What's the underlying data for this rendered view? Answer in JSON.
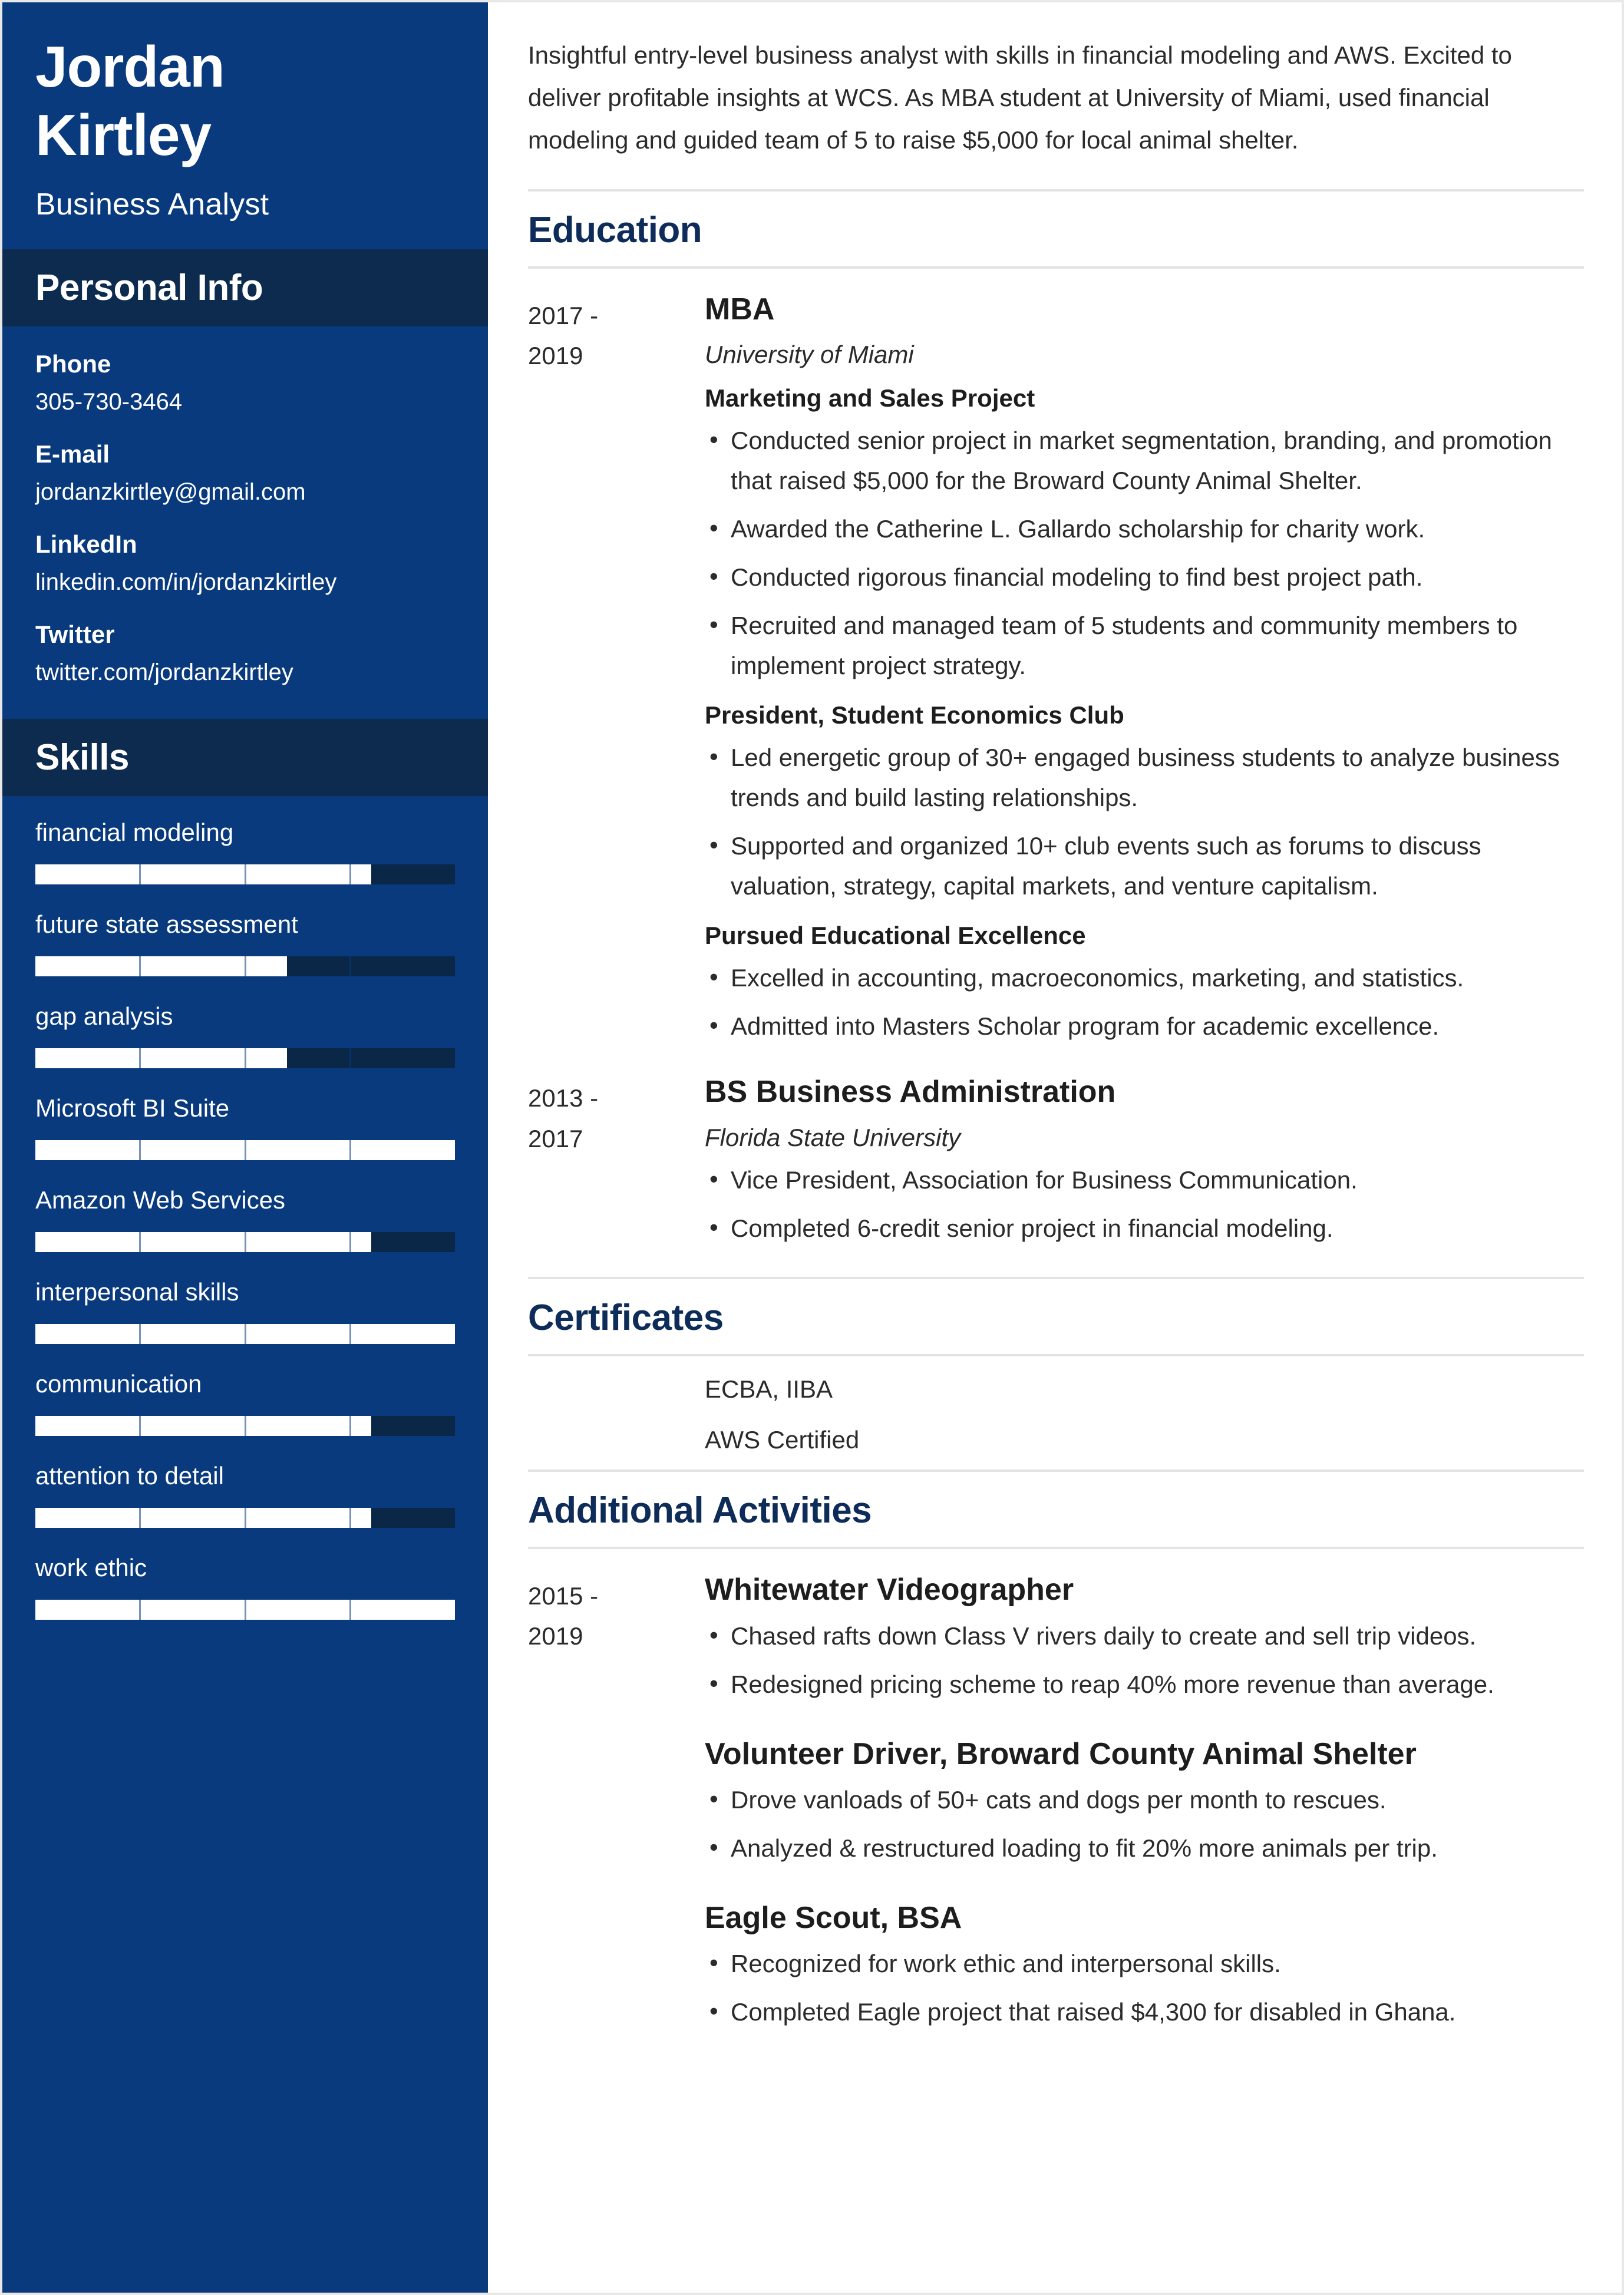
{
  "colors": {
    "sidebar_blue": "#083A7D",
    "sidebar_band_dark": "#0C2B4E",
    "skill_track_dark": "#0A2748",
    "heading_navy": "#0E2C59",
    "body_text": "#2b2b2b"
  },
  "sidebar": {
    "first_name": "Jordan",
    "last_name": "Kirtley",
    "job_title": "Business Analyst",
    "personal_info_heading": "Personal Info",
    "contacts": [
      {
        "label": "Phone",
        "value": "305-730-3464"
      },
      {
        "label": "E-mail",
        "value": "jordanzkirtley@gmail.com"
      },
      {
        "label": "LinkedIn",
        "value": "linkedin.com/in/jordanzkirtley"
      },
      {
        "label": "Twitter",
        "value": "twitter.com/jordanzkirtley"
      }
    ],
    "skills_heading": "Skills",
    "skills": [
      {
        "name": "financial modeling",
        "level": 80
      },
      {
        "name": "future state assessment",
        "level": 60
      },
      {
        "name": "gap analysis",
        "level": 60
      },
      {
        "name": "Microsoft BI Suite",
        "level": 100
      },
      {
        "name": "Amazon Web Services",
        "level": 80
      },
      {
        "name": "interpersonal skills",
        "level": 100
      },
      {
        "name": "communication",
        "level": 80
      },
      {
        "name": "attention to detail",
        "level": 80
      },
      {
        "name": "work ethic",
        "level": 100
      }
    ]
  },
  "main": {
    "summary": "Insightful entry-level business analyst with skills in financial modeling and AWS. Excited to deliver profitable insights at WCS. As MBA student at University of Miami, used financial modeling and guided team of 5 to raise $5,000 for local animal shelter.",
    "education_heading": "Education",
    "education": [
      {
        "date_start": "2017 -",
        "date_end": "2019",
        "title": "MBA",
        "org": "University of Miami",
        "groups": [
          {
            "subhead": "Marketing and Sales Project",
            "bullets": [
              "Conducted senior project in market segmentation, branding, and promotion that raised $5,000 for the Broward County Animal Shelter.",
              "Awarded the Catherine L. Gallardo scholarship for charity work.",
              "Conducted rigorous financial modeling to find best project path.",
              "Recruited and managed team of 5 students and community members to implement project strategy."
            ]
          },
          {
            "subhead": "President, Student Economics Club",
            "bullets": [
              "Led energetic group of 30+ engaged business students to analyze business trends and build lasting relationships.",
              "Supported and organized 10+ club events such as forums to discuss valuation, strategy, capital markets, and venture capitalism."
            ]
          },
          {
            "subhead": "Pursued Educational Excellence",
            "bullets": [
              "Excelled in accounting, macroeconomics, marketing, and statistics.",
              "Admitted into Masters Scholar program for academic excellence."
            ]
          }
        ]
      },
      {
        "date_start": "2013 -",
        "date_end": "2017",
        "title": "BS Business Administration",
        "org": "Florida State University",
        "groups": [
          {
            "subhead": "",
            "bullets": [
              "Vice President, Association for Business Communication.",
              "Completed 6-credit senior project in financial modeling."
            ]
          }
        ]
      }
    ],
    "certificates_heading": "Certificates",
    "certificates": [
      "ECBA, IIBA",
      "AWS Certified"
    ],
    "activities_heading": "Additional Activities",
    "activities": {
      "date_start": "2015 -",
      "date_end": "2019",
      "items": [
        {
          "title": "Whitewater Videographer",
          "bullets": [
            "Chased rafts down Class V rivers daily to create and sell trip videos.",
            "Redesigned pricing scheme to reap 40% more revenue than average."
          ]
        },
        {
          "title": "Volunteer Driver, Broward County Animal Shelter",
          "bullets": [
            "Drove vanloads of 50+ cats and dogs per month to rescues.",
            "Analyzed & restructured loading to fit 20% more animals per trip."
          ]
        },
        {
          "title": "Eagle Scout, BSA",
          "bullets": [
            "Recognized for work ethic and interpersonal skills.",
            "Completed Eagle project that raised $4,300 for disabled in Ghana."
          ]
        }
      ]
    }
  }
}
